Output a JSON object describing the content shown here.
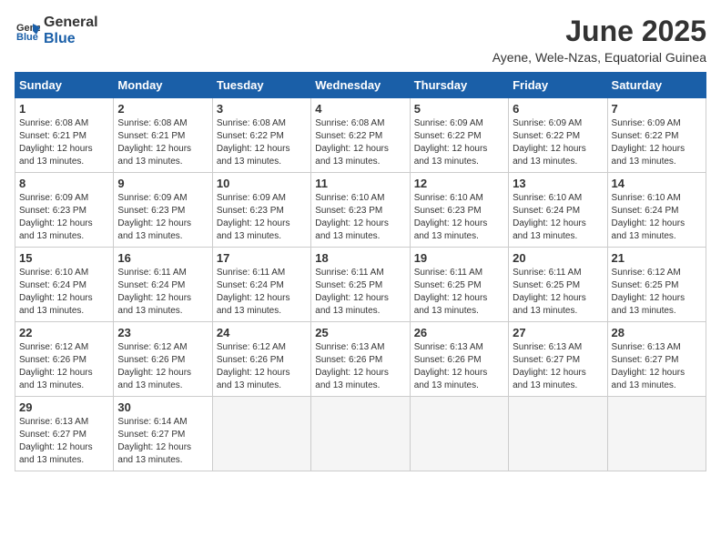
{
  "header": {
    "logo_general": "General",
    "logo_blue": "Blue",
    "title": "June 2025",
    "subtitle": "Ayene, Wele-Nzas, Equatorial Guinea"
  },
  "weekdays": [
    "Sunday",
    "Monday",
    "Tuesday",
    "Wednesday",
    "Thursday",
    "Friday",
    "Saturday"
  ],
  "weeks": [
    [
      {
        "day": "1",
        "sunrise": "6:08 AM",
        "sunset": "6:21 PM",
        "daylight": "12 hours and 13 minutes."
      },
      {
        "day": "2",
        "sunrise": "6:08 AM",
        "sunset": "6:21 PM",
        "daylight": "12 hours and 13 minutes."
      },
      {
        "day": "3",
        "sunrise": "6:08 AM",
        "sunset": "6:22 PM",
        "daylight": "12 hours and 13 minutes."
      },
      {
        "day": "4",
        "sunrise": "6:08 AM",
        "sunset": "6:22 PM",
        "daylight": "12 hours and 13 minutes."
      },
      {
        "day": "5",
        "sunrise": "6:09 AM",
        "sunset": "6:22 PM",
        "daylight": "12 hours and 13 minutes."
      },
      {
        "day": "6",
        "sunrise": "6:09 AM",
        "sunset": "6:22 PM",
        "daylight": "12 hours and 13 minutes."
      },
      {
        "day": "7",
        "sunrise": "6:09 AM",
        "sunset": "6:22 PM",
        "daylight": "12 hours and 13 minutes."
      }
    ],
    [
      {
        "day": "8",
        "sunrise": "6:09 AM",
        "sunset": "6:23 PM",
        "daylight": "12 hours and 13 minutes."
      },
      {
        "day": "9",
        "sunrise": "6:09 AM",
        "sunset": "6:23 PM",
        "daylight": "12 hours and 13 minutes."
      },
      {
        "day": "10",
        "sunrise": "6:09 AM",
        "sunset": "6:23 PM",
        "daylight": "12 hours and 13 minutes."
      },
      {
        "day": "11",
        "sunrise": "6:10 AM",
        "sunset": "6:23 PM",
        "daylight": "12 hours and 13 minutes."
      },
      {
        "day": "12",
        "sunrise": "6:10 AM",
        "sunset": "6:23 PM",
        "daylight": "12 hours and 13 minutes."
      },
      {
        "day": "13",
        "sunrise": "6:10 AM",
        "sunset": "6:24 PM",
        "daylight": "12 hours and 13 minutes."
      },
      {
        "day": "14",
        "sunrise": "6:10 AM",
        "sunset": "6:24 PM",
        "daylight": "12 hours and 13 minutes."
      }
    ],
    [
      {
        "day": "15",
        "sunrise": "6:10 AM",
        "sunset": "6:24 PM",
        "daylight": "12 hours and 13 minutes."
      },
      {
        "day": "16",
        "sunrise": "6:11 AM",
        "sunset": "6:24 PM",
        "daylight": "12 hours and 13 minutes."
      },
      {
        "day": "17",
        "sunrise": "6:11 AM",
        "sunset": "6:24 PM",
        "daylight": "12 hours and 13 minutes."
      },
      {
        "day": "18",
        "sunrise": "6:11 AM",
        "sunset": "6:25 PM",
        "daylight": "12 hours and 13 minutes."
      },
      {
        "day": "19",
        "sunrise": "6:11 AM",
        "sunset": "6:25 PM",
        "daylight": "12 hours and 13 minutes."
      },
      {
        "day": "20",
        "sunrise": "6:11 AM",
        "sunset": "6:25 PM",
        "daylight": "12 hours and 13 minutes."
      },
      {
        "day": "21",
        "sunrise": "6:12 AM",
        "sunset": "6:25 PM",
        "daylight": "12 hours and 13 minutes."
      }
    ],
    [
      {
        "day": "22",
        "sunrise": "6:12 AM",
        "sunset": "6:26 PM",
        "daylight": "12 hours and 13 minutes."
      },
      {
        "day": "23",
        "sunrise": "6:12 AM",
        "sunset": "6:26 PM",
        "daylight": "12 hours and 13 minutes."
      },
      {
        "day": "24",
        "sunrise": "6:12 AM",
        "sunset": "6:26 PM",
        "daylight": "12 hours and 13 minutes."
      },
      {
        "day": "25",
        "sunrise": "6:13 AM",
        "sunset": "6:26 PM",
        "daylight": "12 hours and 13 minutes."
      },
      {
        "day": "26",
        "sunrise": "6:13 AM",
        "sunset": "6:26 PM",
        "daylight": "12 hours and 13 minutes."
      },
      {
        "day": "27",
        "sunrise": "6:13 AM",
        "sunset": "6:27 PM",
        "daylight": "12 hours and 13 minutes."
      },
      {
        "day": "28",
        "sunrise": "6:13 AM",
        "sunset": "6:27 PM",
        "daylight": "12 hours and 13 minutes."
      }
    ],
    [
      {
        "day": "29",
        "sunrise": "6:13 AM",
        "sunset": "6:27 PM",
        "daylight": "12 hours and 13 minutes."
      },
      {
        "day": "30",
        "sunrise": "6:14 AM",
        "sunset": "6:27 PM",
        "daylight": "12 hours and 13 minutes."
      },
      null,
      null,
      null,
      null,
      null
    ]
  ],
  "labels": {
    "sunrise": "Sunrise:",
    "sunset": "Sunset:",
    "daylight": "Daylight:"
  }
}
